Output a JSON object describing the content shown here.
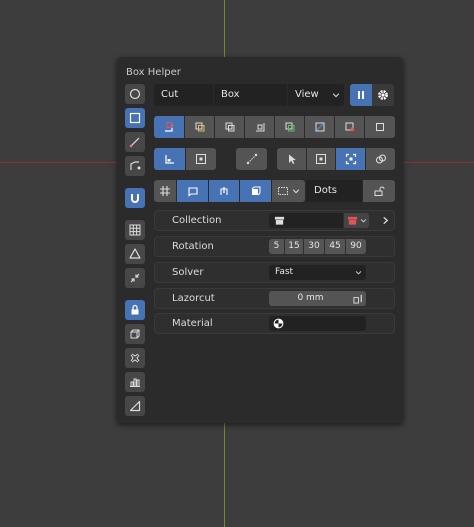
{
  "panel": {
    "title": "Box Helper"
  },
  "header": {
    "mode_value": "Cut",
    "shape_value": "Box",
    "orient_value": "View"
  },
  "options": {
    "dots_value": "Dots"
  },
  "rows": {
    "collection_label": "Collection",
    "rotation_label": "Rotation",
    "rotation_values": [
      "5",
      "15",
      "30",
      "45",
      "90"
    ],
    "solver_label": "Solver",
    "solver_value": "Fast",
    "lazorcut_label": "Lazorcut",
    "lazorcut_value": "0 mm",
    "material_label": "Material"
  },
  "colors": {
    "accent": "#4772b3",
    "panel_bg": "#2b2b2b",
    "viewport_bg": "#3d3d3d",
    "x_axis": "#8a2f33",
    "y_axis": "#6a8f2a"
  },
  "icons": [
    "circle-icon",
    "square-icon",
    "knife-icon",
    "ngon-icon",
    "snap-magnet-icon",
    "grid-icon",
    "custom-shape-icon",
    "shrink-icon",
    "lock-icon",
    "cube-icon",
    "dots-icon",
    "bars-icon",
    "wedge-icon",
    "pause-icon",
    "gear-icon",
    "box-dot-icon",
    "corner-icon",
    "pointer-icon",
    "collection-icon",
    "material-sphere-icon"
  ]
}
